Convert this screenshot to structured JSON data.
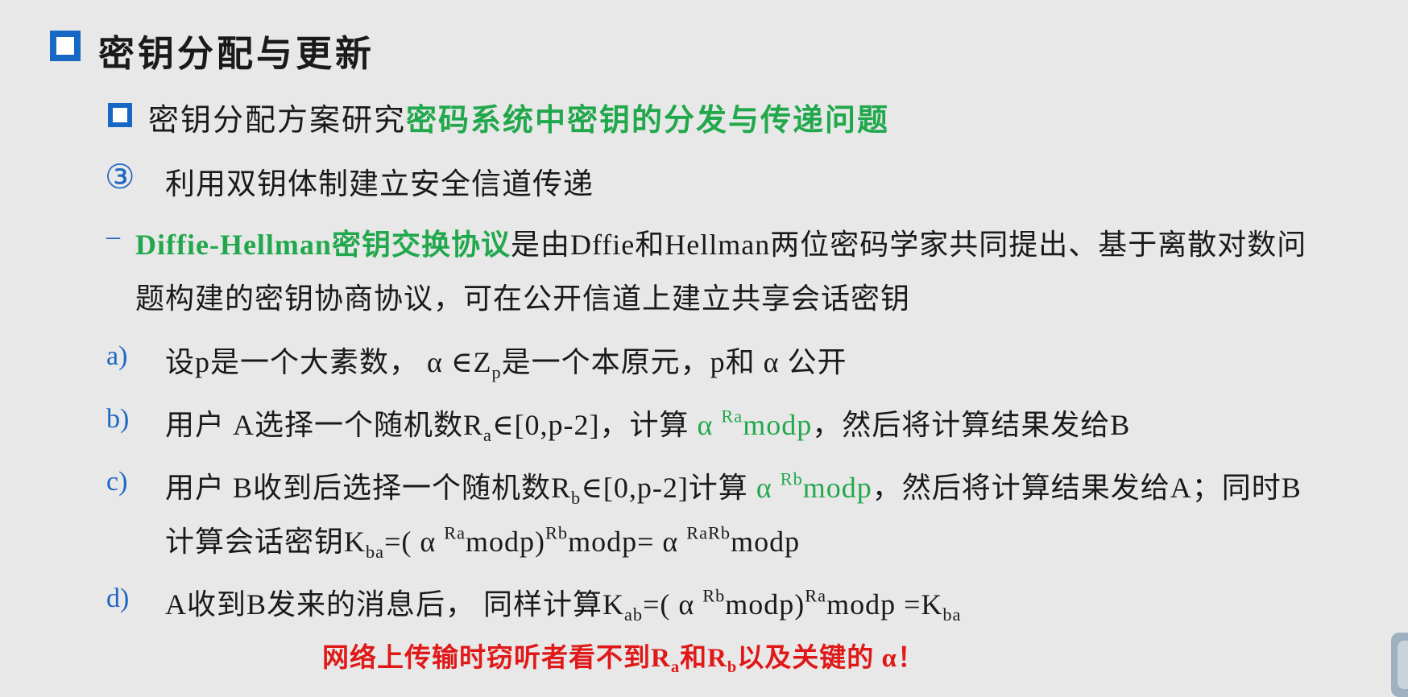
{
  "title": "密钥分配与更新",
  "subtitle": {
    "prefix": "密钥分配方案研究",
    "highlight": "密码系统中密钥的分发与传递问题"
  },
  "item3": {
    "marker": "③",
    "text": "利用双钥体制建立安全信道传递"
  },
  "dh": {
    "dash": "–",
    "highlight": "Diffie-Hellman密钥交换协议",
    "line1_rest": "是由Dffie和Hellman两位密码学家共同提出、基于离散对数问",
    "line2": "题构建的密钥协商协议，可在公开信道上建立共享会话密钥"
  },
  "a": {
    "label": "a)",
    "t1": "设p是一个大素数， α ∈Z",
    "sub1": "p",
    "t2": "是一个本原元，p和 α 公开"
  },
  "b": {
    "label": "b)",
    "t1": "用户 A选择一个随机数R",
    "sub1": "a",
    "t2": "∈[0,p-2]，计算 ",
    "g_alpha": "α ",
    "g_sup": "Ra",
    "g_mod": "modp",
    "t3": "，然后将计算结果发给B"
  },
  "c": {
    "label": "c)",
    "t1": "用户 B收到后选择一个随机数R",
    "sub1": "b",
    "t2": "∈[0,p-2]计算 ",
    "g_alpha": "α ",
    "g_sup": "Rb",
    "g_mod": "modp",
    "t3": "，然后将计算结果发给A；同时B",
    "l2_t1": "计算会话密钥K",
    "l2_sub1": "ba",
    "l2_t2": "=( α ",
    "l2_sup1": "Ra",
    "l2_t3": "modp)",
    "l2_sup2": "Rb",
    "l2_t4": "modp= α ",
    "l2_sup3": "RaRb",
    "l2_t5": "modp"
  },
  "d": {
    "label": "d)",
    "t1": "A收到B发来的消息后， 同样计算K",
    "sub1": "ab",
    "t2": "=( α ",
    "sup1": "Rb",
    "t3": "modp)",
    "sup2": "Ra",
    "t4": "modp  =K",
    "sub2": "ba"
  },
  "warning": {
    "t1": "网络上传输时窃听者看不到R",
    "sub1": "a",
    "t2": "和R",
    "sub2": "b",
    "t3": "以及关键的 α！"
  },
  "colors": {
    "accent_blue": "#1668c4",
    "green": "#22a84c",
    "red": "#e01818"
  }
}
